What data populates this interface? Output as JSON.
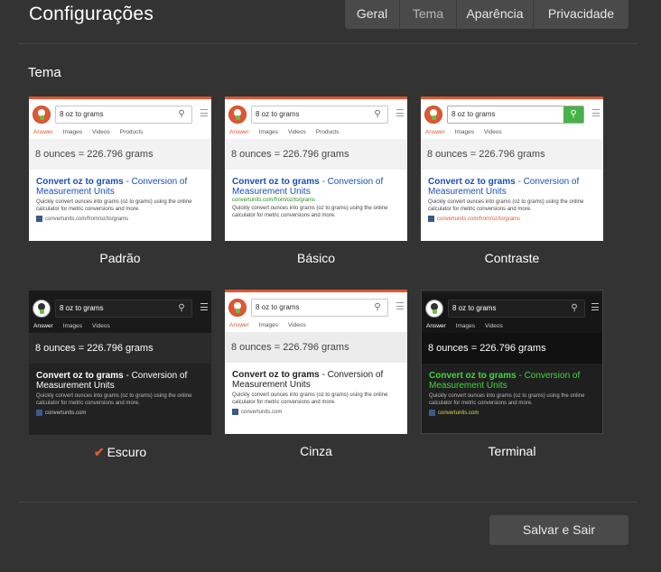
{
  "header": {
    "title": "Configurações",
    "tabs": [
      {
        "label": "Geral",
        "active": false
      },
      {
        "label": "Tema",
        "active": true
      },
      {
        "label": "Aparência",
        "active": false
      },
      {
        "label": "Privacidade",
        "active": false
      }
    ]
  },
  "section": {
    "title": "Tema"
  },
  "preview_content": {
    "query": "8 oz to grams",
    "nav": [
      "Answer",
      "Images",
      "Videos",
      "Products"
    ],
    "answer_left": "8 ounces = ",
    "answer_right": "226.796 grams",
    "result_title_bold": "Convert oz to grams",
    "result_title_rest": " - Conversion of Measurement Units",
    "result_url": "convertunits.com/from/oz/to/grams",
    "result_snippet": "Quickly convert ounces into grams (oz to grams) using the online calculator for metric conversions and more.",
    "result_footer_long": "convertunits.com/from/oz/to/grams",
    "result_footer_short": "convertunits.com"
  },
  "themes": [
    {
      "label": "Padrão",
      "selected": false
    },
    {
      "label": "Básico",
      "selected": false
    },
    {
      "label": "Contraste",
      "selected": false
    },
    {
      "label": "Escuro",
      "selected": true
    },
    {
      "label": "Cinza",
      "selected": false
    },
    {
      "label": "Terminal",
      "selected": false
    }
  ],
  "selected_check": "✔",
  "footer": {
    "save_label": "Salvar e Sair"
  },
  "colors": {
    "accent": "#de5833",
    "background": "#333333",
    "tab_bg": "#4a4a4a",
    "terminal_green": "#3fd63f"
  }
}
